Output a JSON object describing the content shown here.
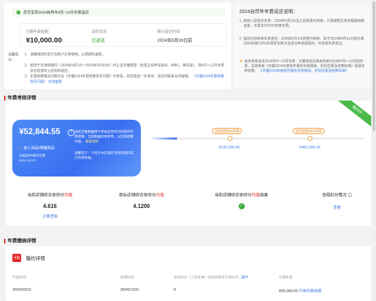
{
  "top": {
    "notice": "您可享受2024自然年9月~12月年费返还",
    "summary": {
      "fee_paid_label": "已缴年费金额",
      "fee_paid_value": "¥10,000.00",
      "refund_status_label": "返还状态",
      "refund_status_value": "已返还",
      "expected_time_label": "预计返还时间",
      "expected_time_value": "2024年9月30日前"
    },
    "tips": {
      "label": "温馨提示：",
      "items": [
        "请确保您的支付宝账户正常使用，以便顺利退款。",
        "若您于本通知期间（2024年9月1日～2024年9月30日）终止在天猫经营（包括主动申请退出、B转C、被清退），则9月～12月年费会在经营终止后协商退还。",
        "年费结算相关问题可在《天猫2024年费结算常见问题》中查看，如您需进一步咨询，请及时联系在线客服。"
      ],
      "faq_link": "《天猫2024年费结算常见问题》",
      "service_link": "在线客服"
    }
  },
  "side_notes": {
    "title": "2024自然年年费返还说明：",
    "notes": [
      "新商入驻免交年费：2024年9月1日及之后新签约商家，只需按照正常流程缴纳保证金，无需支付2024年度年费。",
      "提前达标商家年费返还：2024年9月1日前签约商家，如于2024年8月31日前达成2024年度100%年费折扣条件且成功申请提现的，可享受年费返还。",
      "其余商家返还2024年9～12月年费：天猫将返还其余商家2024年9月～12月的年费，具体参考《天猫2024年度软件服务年费缴纳、折扣优惠及结算标准》保留年终结算。"
    ],
    "rules_link": "《天猫2024年度软件服务年费缴纳、折扣优惠及结算标准》"
  },
  "assessment": {
    "section_title": "年费考核详情",
    "ribbon": "履约中",
    "card": {
      "amount": "¥52,844.55",
      "question_mark": "?",
      "tip": "该成交额数据用于考核自然年内的软件年费结算，当前数据仅供参考，以实际结算为准。",
      "tip_link": "查看规则",
      "label": "成人用品/情趣用品",
      "meta_line1": "天猫软件服务年费",
      "meta_line2": "2024-10-07",
      "hint": "温馨提示：只统计本店铺在考核周期内成交的销售额。"
    },
    "milestones": [
      {
        "label": "全年返回50%年费",
        "value": "¥135,000.00"
      },
      {
        "label": "全年返回100%年费",
        "value": "¥450,000.00"
      }
    ],
    "progress_fraction": 0.13,
    "metrics": [
      {
        "label_pre": "当前店铺综合体验分",
        "label_hl": "均值",
        "value": "4.616",
        "link": "计算逻辑"
      },
      {
        "label_pre": "目标店铺综合体验分",
        "label_hl": "均值",
        "value": "4.1200"
      },
      {
        "label_pre": "当前店铺综合体验分",
        "label_hl": "均值",
        "label_post": "结果"
      },
      {
        "label_pre": "违规扣分情况",
        "link": "查看"
      }
    ]
  },
  "fee_detail": {
    "section_title": "年费缴纳详情",
    "brand": "天猫",
    "title": "履约详情",
    "columns": {
      "start": "开始时间",
      "end": "结束时间",
      "duration_pre": "有效均分（入驻未满一年的商家进行等比年...",
      "duration_link": "展开",
      "paid": "已缴年费"
    },
    "row": {
      "start": "2024/03/12",
      "end": "2024/12/31",
      "duration": "9",
      "paid": "¥25,000.00",
      "action": "开具年费收据"
    }
  },
  "colors": {
    "accent_blue": "#3a6ff0",
    "success_green": "#3aae3a",
    "alert_red": "#e02a2a",
    "milestone_orange": "#f39b3d"
  }
}
